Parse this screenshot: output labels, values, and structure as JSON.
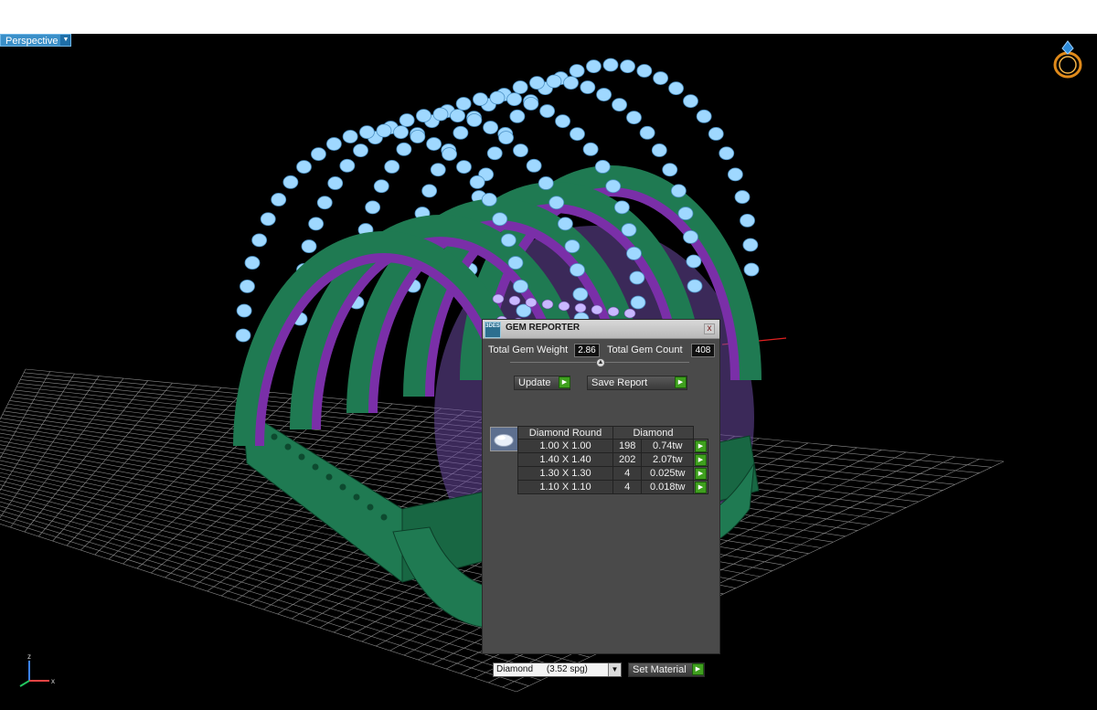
{
  "viewport": {
    "label": "Perspective",
    "background": "#000000",
    "axis": {
      "z": "z",
      "x": "x"
    }
  },
  "gem_reporter": {
    "title": "GEM REPORTER",
    "logo_text": "3DES",
    "close_label": "x",
    "total_weight_label": "Total Gem Weight",
    "total_weight_value": "2.86",
    "total_count_label": "Total Gem Count",
    "total_count_value": "408",
    "update_label": "Update",
    "save_report_label": "Save Report",
    "table": {
      "headers": [
        "Diamond Round",
        "Diamond"
      ],
      "rows": [
        {
          "size": "1.00 X 1.00",
          "count": "198",
          "weight": "0.74tw"
        },
        {
          "size": "1.40 X 1.40",
          "count": "202",
          "weight": "2.07tw"
        },
        {
          "size": "1.30 X 1.30",
          "count": "4",
          "weight": "0.025tw"
        },
        {
          "size": "1.10 X 1.10",
          "count": "4",
          "weight": "0.018tw"
        }
      ]
    },
    "material_select": {
      "name": "Diamond",
      "spg": "(3.52 spg)"
    },
    "set_material_label": "Set Material"
  },
  "colors": {
    "band": "#1f7a52",
    "band_light": "#3aa876",
    "channel": "#7a2fa8",
    "gem": "#9fd8ff",
    "grid": "#8a8a8a",
    "panel": "#4a4a4a",
    "go": "#3fa01e"
  }
}
